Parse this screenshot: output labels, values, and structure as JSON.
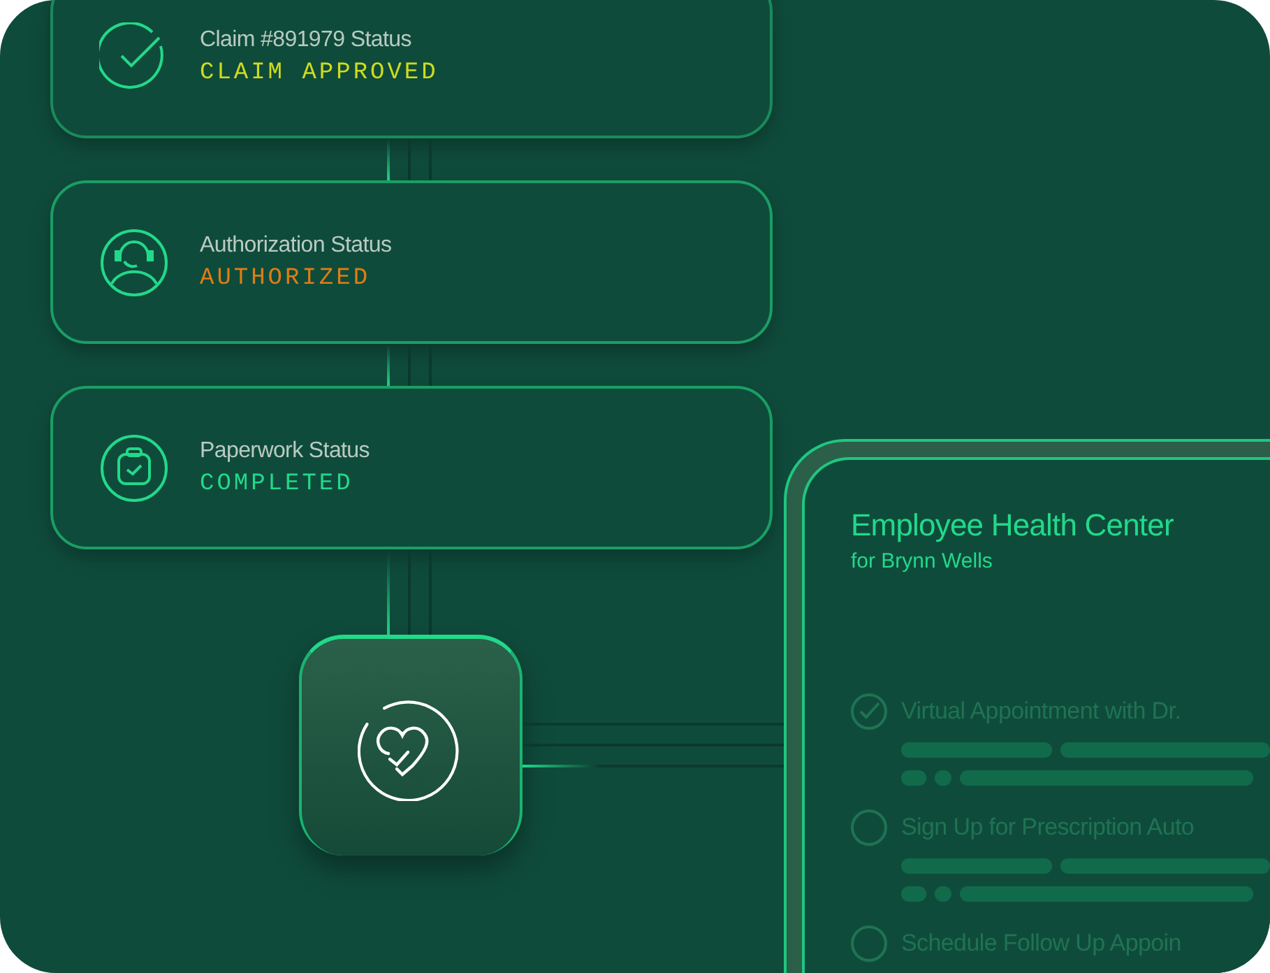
{
  "status_cards": [
    {
      "title": "Claim #891979 Status",
      "status": "CLAIM APPROVED",
      "color": "#cfdc1c"
    },
    {
      "title": "Authorization Status",
      "status": "AUTHORIZED",
      "color": "#e07d12"
    },
    {
      "title": "Paperwork Status",
      "status": "COMPLETED",
      "color": "#22d98a"
    }
  ],
  "panel": {
    "title": "Employee Health Center",
    "subtitle": "for Brynn Wells",
    "tasks": [
      {
        "label": "Virtual Appointment with Dr.",
        "checked": true
      },
      {
        "label": "Sign Up for Prescription Auto",
        "checked": false
      },
      {
        "label": "Schedule Follow Up Appoin",
        "checked": false
      }
    ]
  }
}
